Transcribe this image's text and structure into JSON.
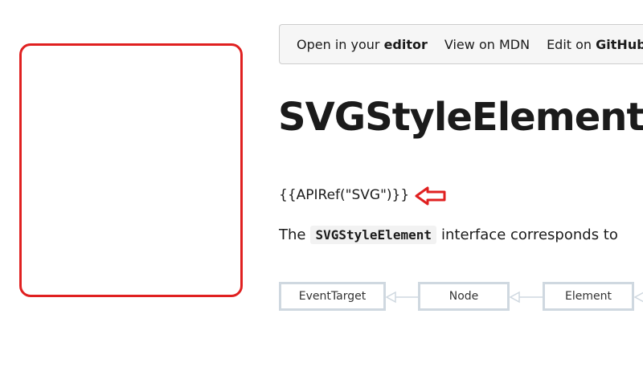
{
  "toolbar": {
    "open_editor_prefix": "Open in your ",
    "open_editor_bold": "editor",
    "view_mdn": "View on MDN",
    "edit_prefix": "Edit on ",
    "edit_bold": "GitHub"
  },
  "page": {
    "title": "SVGStyleElement",
    "apiref": "{{APIRef(\"SVG\")}}",
    "intro_prefix": "The",
    "intro_code": "SVGStyleElement",
    "intro_suffix": "interface corresponds to"
  },
  "inheritance": {
    "nodes": [
      "EventTarget",
      "Node",
      "Element"
    ]
  },
  "colors": {
    "highlight_red": "#e02020",
    "diagram_border": "#cfd8e0"
  }
}
